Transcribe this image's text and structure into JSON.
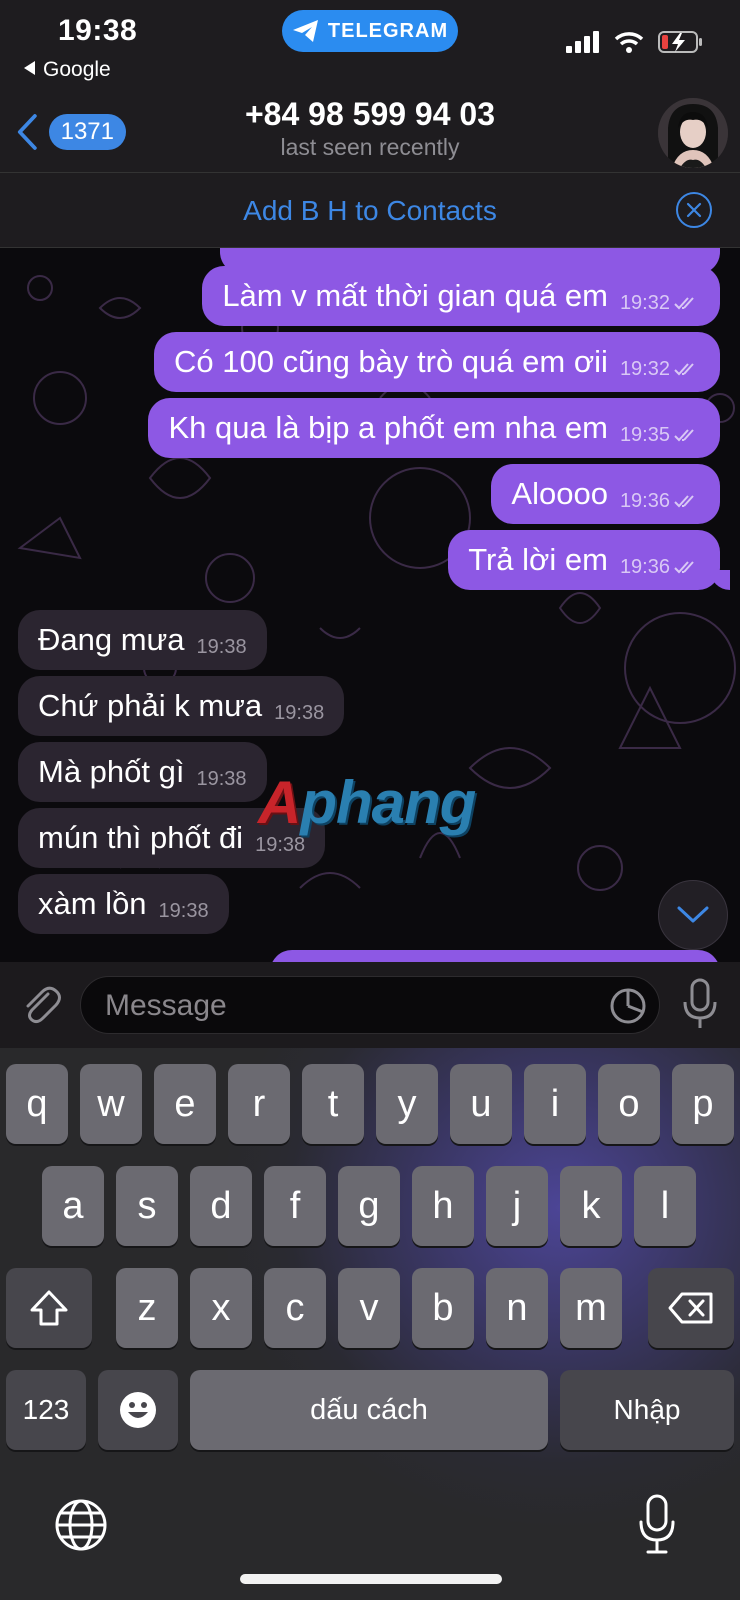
{
  "status_bar": {
    "time": "19:38",
    "back_app": "Google",
    "app_pill": "TELEGRAM"
  },
  "header": {
    "back_count": "1371",
    "title": "+84 98 599 94 03",
    "subtitle": "last seen recently"
  },
  "add_contact": {
    "label": "Add B H to Contacts"
  },
  "messages": [
    {
      "direction": "out",
      "text": "Làm v mất thời gian quá em",
      "time": "19:32",
      "read": true
    },
    {
      "direction": "out",
      "text": "Có 100 cũng bày trò quá em ơii",
      "time": "19:32",
      "read": true
    },
    {
      "direction": "out",
      "text": "Kh qua là bịp a phốt em nha em",
      "time": "19:35",
      "read": true
    },
    {
      "direction": "out",
      "text": "Aloooo",
      "time": "19:36",
      "read": true
    },
    {
      "direction": "out",
      "text": "Trả lời em",
      "time": "19:36",
      "read": true
    },
    {
      "direction": "in",
      "text": "Đang mưa",
      "time": "19:38"
    },
    {
      "direction": "in",
      "text": "Chứ phải k mưa",
      "time": "19:38"
    },
    {
      "direction": "in",
      "text": "Mà phốt gì",
      "time": "19:38"
    },
    {
      "direction": "in",
      "text": "mún thì phốt đi",
      "time": "19:38"
    },
    {
      "direction": "in",
      "text": "xàm lồn",
      "time": "19:38"
    }
  ],
  "watermark": {
    "first": "A",
    "rest": "phang"
  },
  "composer": {
    "placeholder": "Message"
  },
  "keyboard": {
    "row1": [
      "q",
      "w",
      "e",
      "r",
      "t",
      "y",
      "u",
      "i",
      "o",
      "p"
    ],
    "row2": [
      "a",
      "s",
      "d",
      "f",
      "g",
      "h",
      "j",
      "k",
      "l"
    ],
    "row3": [
      "z",
      "x",
      "c",
      "v",
      "b",
      "n",
      "m"
    ],
    "numbers_label": "123",
    "space_label": "dấu cách",
    "return_label": "Nhập"
  },
  "colors": {
    "outgoing_bubble": "#8d58e4",
    "incoming_bubble": "#2b2530",
    "accent": "#3d87e4",
    "telegram_pill": "#2b8cf0"
  },
  "icons": [
    "back-chevron-icon",
    "telegram-plane-icon",
    "signal-icon",
    "wifi-icon",
    "battery-charging-icon",
    "close-icon",
    "double-check-icon",
    "chevron-down-icon",
    "paperclip-icon",
    "sticker-icon",
    "microphone-icon",
    "shift-icon",
    "backspace-icon",
    "emoji-icon",
    "globe-icon"
  ]
}
